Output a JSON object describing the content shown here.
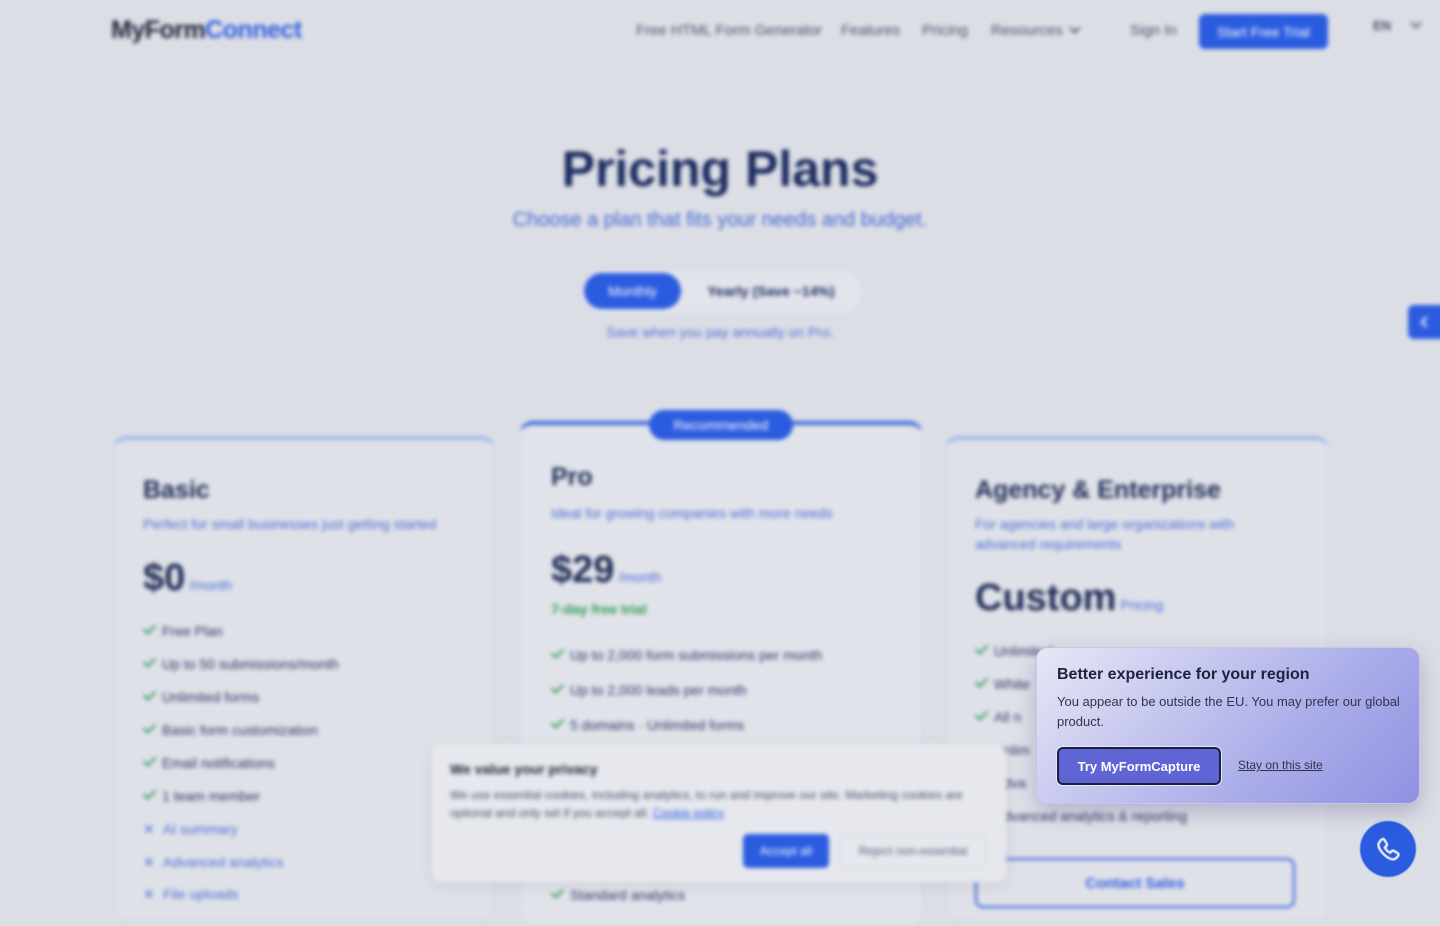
{
  "nav": {
    "logo_part1": "MyForm",
    "logo_part2": "Connect",
    "links": [
      "Free HTML Form Generator",
      "Features",
      "Pricing",
      "Resources"
    ],
    "sign_in": "Sign In",
    "cta": "Start Free Trial",
    "language": "EN"
  },
  "hero": {
    "title": "Pricing Plans",
    "subtitle": "Choose a plan that fits your needs and budget.",
    "toggle_monthly": "Monthly",
    "toggle_yearly": "Yearly (Save ~14%)",
    "save_note": "Save when you pay annually on Pro."
  },
  "plans": {
    "recommended_badge": "Recommended",
    "basic": {
      "title": "Basic",
      "desc": "Perfect for small businesses just getting started",
      "price": "$0",
      "per": "/month",
      "features": [
        "Free Plan",
        "Up to 50 submissions/month",
        "Unlimited forms",
        "Basic form customization",
        "Email notifications",
        "1 team member"
      ],
      "excluded": [
        "AI summary",
        "Advanced analytics",
        "File uploads"
      ]
    },
    "pro": {
      "title": "Pro",
      "desc": "Ideal for growing companies with more needs",
      "price": "$29",
      "per": "/month",
      "trial": "7-day free trial",
      "features": [
        "Up to 2,000 form submissions per month",
        "Up to 2,000 leads per month",
        "5 domains · Unlimited forms",
        "Standard analytics"
      ]
    },
    "enterprise": {
      "title": "Agency & Enterprise",
      "desc": "For agencies and large organizations with advanced requirements",
      "price": "Custom",
      "per": "Pricing",
      "features": [
        "Unlimited",
        "White",
        "All n",
        "Unlim",
        "Adva",
        "Advanced analytics & reporting"
      ],
      "cta": "Contact Sales"
    }
  },
  "cookie": {
    "title": "We value your privacy",
    "body": "We use essential cookies, including analytics, to run and improve our site. Marketing cookies are optional and only set if you accept all.",
    "link": "Cookie policy",
    "accept": "Accept all",
    "reject": "Reject non-essential"
  },
  "region_popup": {
    "title": "Better experience for your region",
    "body": "You appear to be outside the EU. You may prefer our global product.",
    "try_button": "Try MyFormCapture",
    "stay_link": "Stay on this site"
  },
  "icons": {
    "fab": "phone-icon",
    "side_tab": "chevron-left-icon"
  }
}
